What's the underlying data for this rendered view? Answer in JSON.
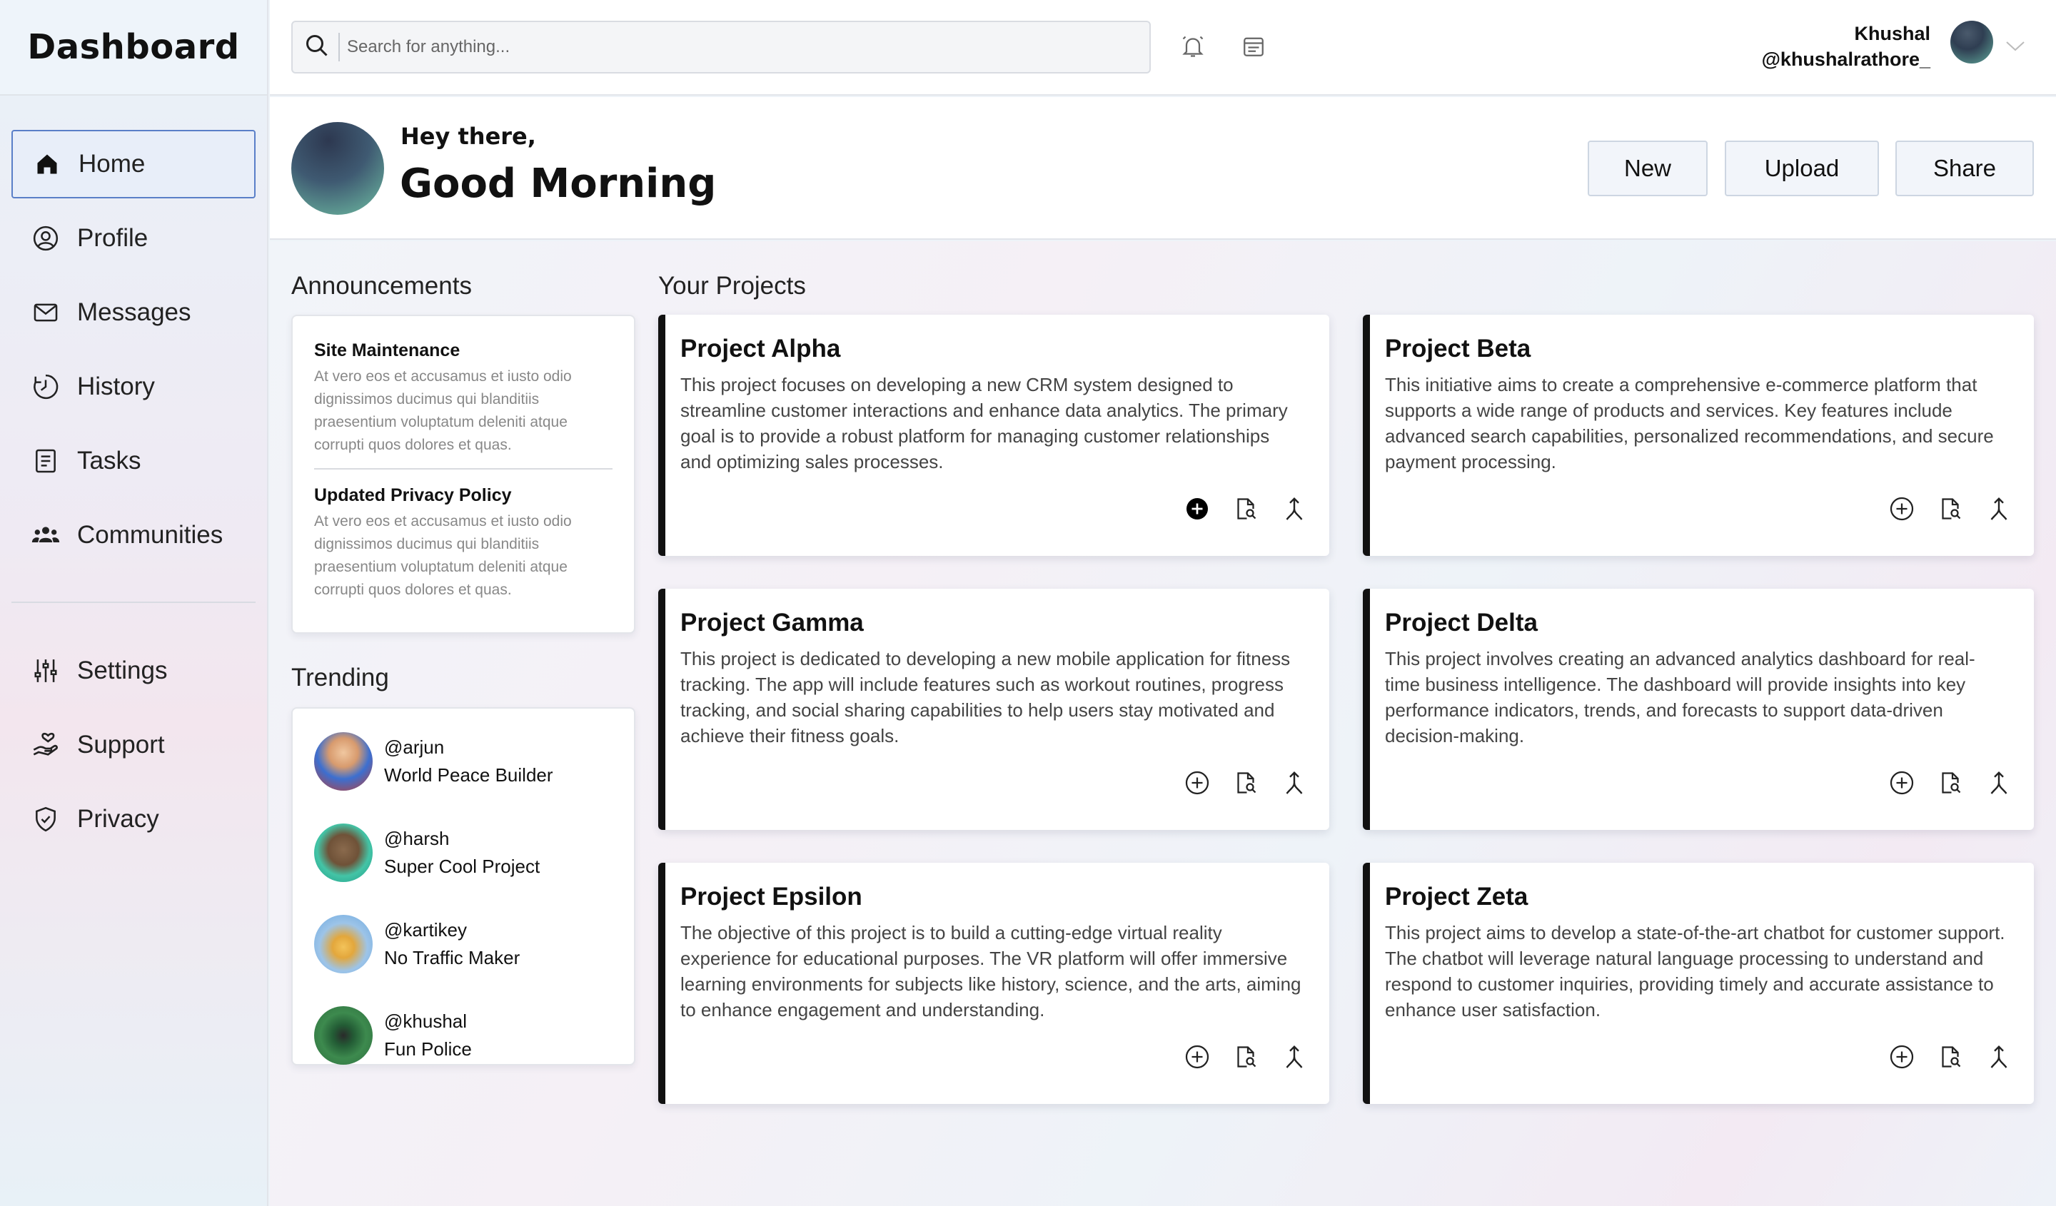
{
  "app": {
    "title": "Dashboard"
  },
  "sidebar": {
    "items": [
      {
        "label": "Home",
        "icon": "home-icon",
        "active": true
      },
      {
        "label": "Profile",
        "icon": "user-circle-icon"
      },
      {
        "label": "Messages",
        "icon": "envelope-icon"
      },
      {
        "label": "History",
        "icon": "history-icon"
      },
      {
        "label": "Tasks",
        "icon": "clipboard-icon"
      },
      {
        "label": "Communities",
        "icon": "people-icon"
      }
    ],
    "secondary": [
      {
        "label": "Settings",
        "icon": "sliders-icon"
      },
      {
        "label": "Support",
        "icon": "hand-heart-icon"
      },
      {
        "label": "Privacy",
        "icon": "shield-check-icon"
      }
    ]
  },
  "topbar": {
    "search_placeholder": "Search for anything...",
    "user_name": "Khushal",
    "user_handle": "@khushalrathore_"
  },
  "header": {
    "greeting_small": "Hey there,",
    "greeting_large": "Good Morning",
    "buttons": {
      "new": "New",
      "upload": "Upload",
      "share": "Share"
    }
  },
  "announcements": {
    "title": "Announcements",
    "items": [
      {
        "title": "Site Maintenance",
        "body": "At vero eos et accusamus et iusto odio dignissimos ducimus qui blanditiis praesentium voluptatum deleniti atque corrupti quos dolores et quas."
      },
      {
        "title": "Updated Privacy Policy",
        "body": "At vero eos et accusamus et iusto odio dignissimos ducimus qui blanditiis praesentium voluptatum deleniti atque corrupti quos dolores et quas."
      }
    ]
  },
  "trending": {
    "title": "Trending",
    "items": [
      {
        "handle": "@arjun",
        "desc": "World Peace Builder"
      },
      {
        "handle": "@harsh",
        "desc": "Super Cool Project"
      },
      {
        "handle": "@kartikey",
        "desc": "No Traffic Maker"
      },
      {
        "handle": "@khushal",
        "desc": "Fun Police"
      }
    ]
  },
  "projects": {
    "title": "Your Projects",
    "items": [
      {
        "title": "Project Alpha",
        "desc": "This project focuses on developing a new CRM system designed to streamline customer interactions and enhance data analytics. The primary goal is to provide a robust platform for managing customer relationships and optimizing sales processes."
      },
      {
        "title": "Project Beta",
        "desc": "This initiative aims to create a comprehensive e-commerce platform that supports a wide range of products and services. Key features include advanced search capabilities, personalized recommendations, and secure payment processing."
      },
      {
        "title": "Project Gamma",
        "desc": "This project is dedicated to developing a new mobile application for fitness tracking. The app will include features such as workout routines, progress tracking, and social sharing capabilities to help users stay motivated and achieve their fitness goals."
      },
      {
        "title": "Project Delta",
        "desc": "This project involves creating an advanced analytics dashboard for real-time business intelligence. The dashboard will provide insights into key performance indicators, trends, and forecasts to support data-driven decision-making."
      },
      {
        "title": "Project Epsilon",
        "desc": "The objective of this project is to build a cutting-edge virtual reality experience for educational purposes. The VR platform will offer immersive learning environments for subjects like history, science, and the arts, aiming to enhance engagement and understanding."
      },
      {
        "title": "Project Zeta",
        "desc": "This project aims to develop a state-of-the-art chatbot for customer support. The chatbot will leverage natural language processing to understand and respond to customer inquiries, providing timely and accurate assistance to enhance user satisfaction."
      }
    ]
  }
}
